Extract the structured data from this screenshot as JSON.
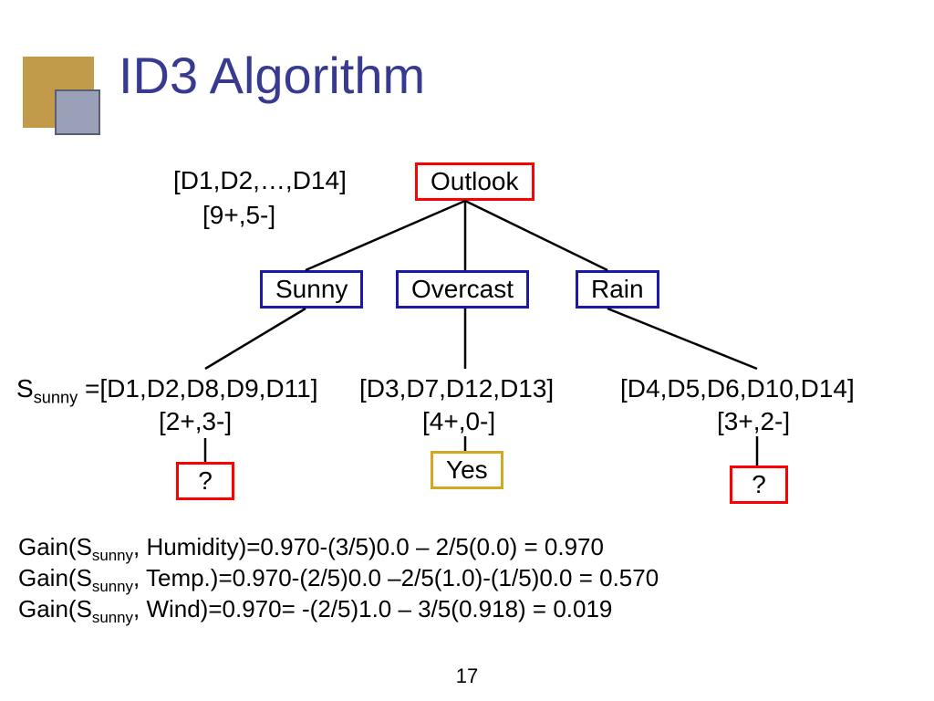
{
  "title": "ID3 Algorithm",
  "page_number": "17",
  "root": {
    "label": "Outlook",
    "data_line1": "[D1,D2,…,D14]",
    "data_line2": "[9+,5-]"
  },
  "branches": {
    "sunny": {
      "label": "Sunny"
    },
    "overcast": {
      "label": "Overcast"
    },
    "rain": {
      "label": "Rain"
    }
  },
  "leaves": {
    "sunny": {
      "prefix": "S",
      "sub": "sunny",
      "eq_list": " =[D1,D2,D8,D9,D11]",
      "counts": "[2+,3-]",
      "result": "?"
    },
    "overcast": {
      "list": "[D3,D7,D12,D13]",
      "counts": "[4+,0-]",
      "result": "Yes"
    },
    "rain": {
      "list": "[D4,D5,D6,D10,D14]",
      "counts": "[3+,2-]",
      "result": "?"
    }
  },
  "gains": {
    "g1_pre": "Gain(S",
    "g1_sub": "sunny",
    "g1_post": ", Humidity)=0.970-(3/5)0.0 – 2/5(0.0) = 0.970",
    "g2_pre": "Gain(S",
    "g2_sub": "sunny",
    "g2_post": ", Temp.)=0.970-(2/5)0.0 –2/5(1.0)-(1/5)0.0 = 0.570",
    "g3_pre": "Gain(S",
    "g3_sub": "sunny",
    "g3_post": ", Wind)=0.970= -(2/5)1.0 – 3/5(0.918) = 0.019"
  }
}
